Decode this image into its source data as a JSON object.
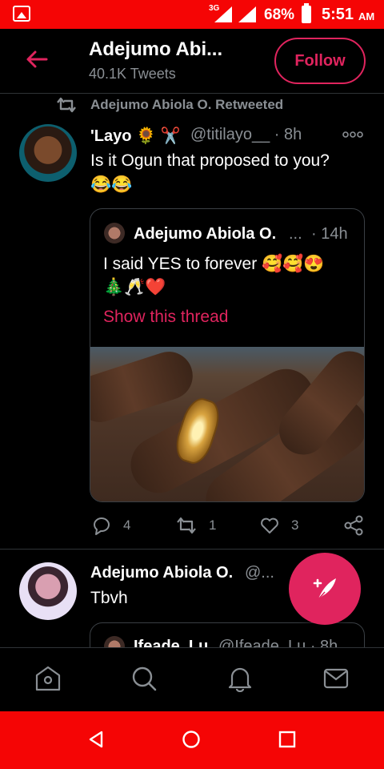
{
  "status_bar": {
    "network": "3G",
    "battery": "68%",
    "time": "5:51",
    "ampm": "AM",
    "color": "#f50505"
  },
  "header": {
    "title": "Adejumo Abi...",
    "subtitle": "40.1K Tweets",
    "follow_label": "Follow",
    "accent": "#e0245e"
  },
  "tweet1": {
    "retweet_label": "Adejumo Abiola O. Retweeted",
    "name": "'Layo 🌻 ✂️",
    "handle": "@titilayo__ · 8h",
    "text": "Is it Ogun that proposed to you?",
    "emoji": "😂😂",
    "quote": {
      "name": "Adejumo Abiola O.",
      "ellipsis": "...",
      "time": "· 14h",
      "text": "I said YES to forever 🥰🥰😍",
      "emoji": "🎄🥂❤️",
      "link": "Show this thread"
    },
    "actions": {
      "replies": "4",
      "retweets": "1",
      "likes": "3"
    }
  },
  "tweet2": {
    "name": "Adejumo Abiola O.",
    "handle": "@...",
    "text": "Tbvh",
    "quote_name": "Ifeade_Lu",
    "quote_handle": "@Ifeade_Lu · 8h"
  },
  "nav": {
    "items": [
      "home-icon",
      "search-icon",
      "notifications-icon",
      "messages-icon"
    ]
  }
}
